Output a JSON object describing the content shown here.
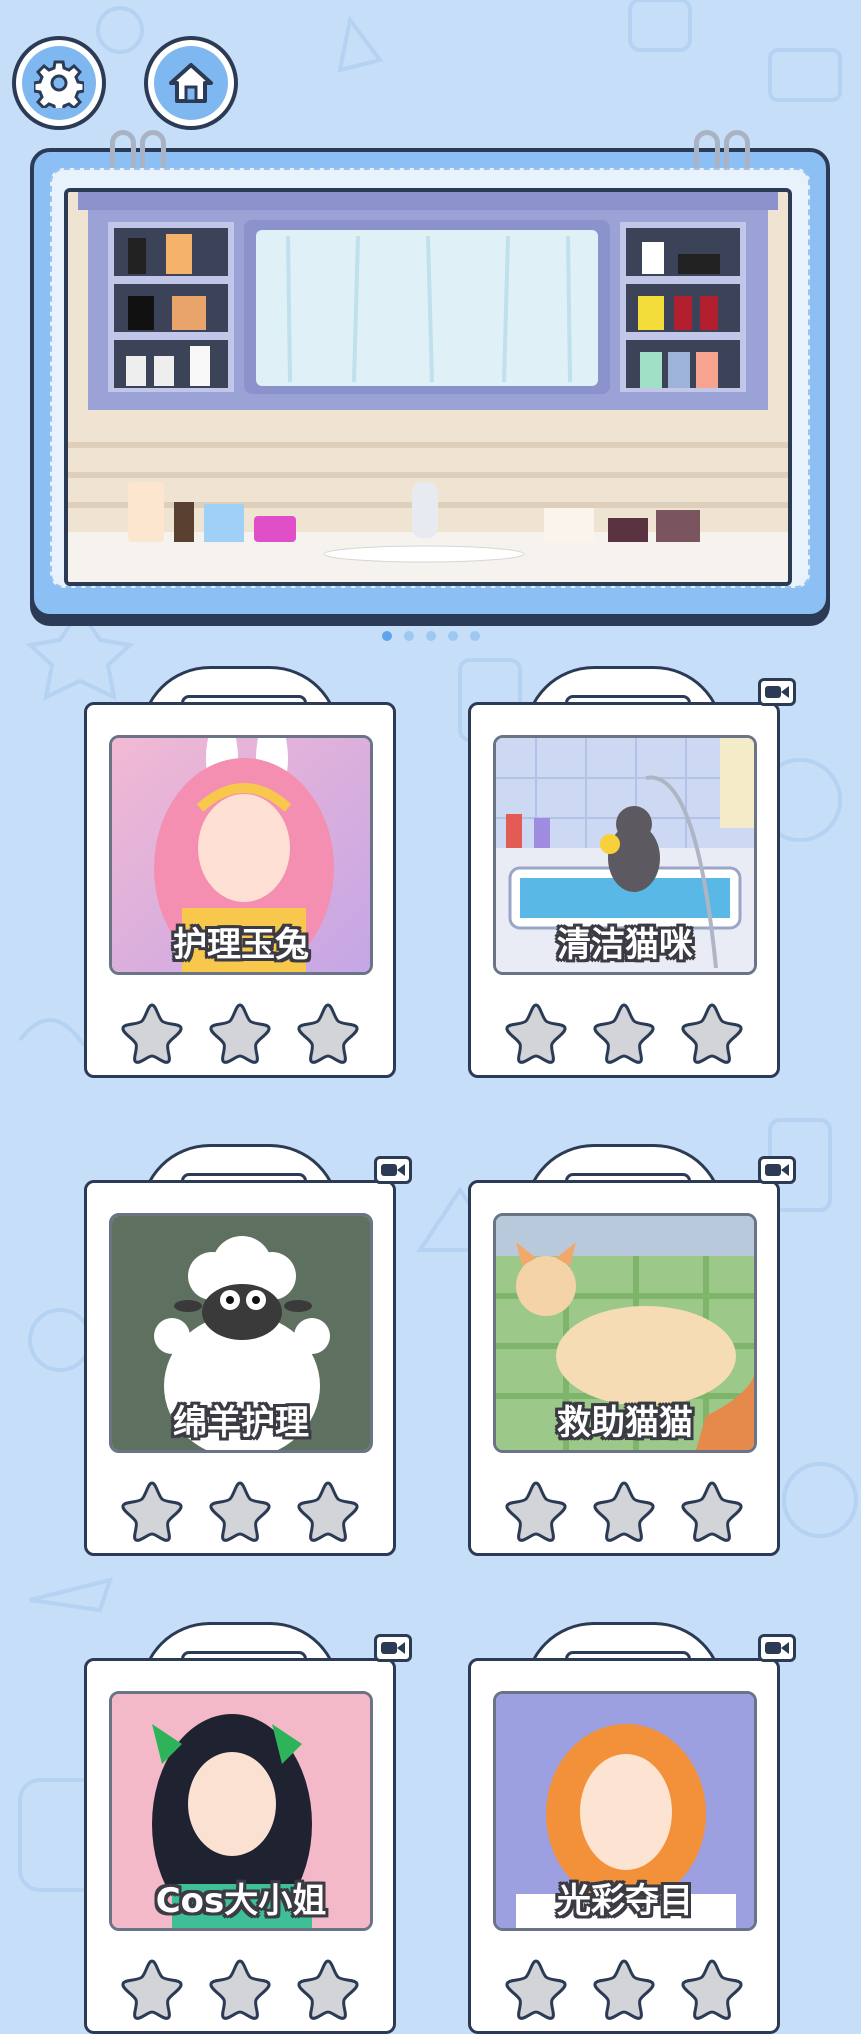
{
  "topbar": {
    "settings_icon": "gear-icon",
    "home_icon": "home-icon"
  },
  "banner": {
    "scene": "bathroom-vanity",
    "page_count": 5,
    "active_page": 1
  },
  "levels": [
    {
      "title": "护理玉兔",
      "video": false,
      "stars": 0,
      "image": "bunny-girl"
    },
    {
      "title": "清洁猫咪",
      "video": true,
      "stars": 0,
      "image": "cat-bath"
    },
    {
      "title": "绵羊护理",
      "video": true,
      "stars": 0,
      "image": "sheep"
    },
    {
      "title": "救助猫猫",
      "video": true,
      "stars": 0,
      "image": "cat-rescue"
    },
    {
      "title": "Cos大小姐",
      "video": true,
      "stars": 0,
      "image": "cosplay-girl"
    },
    {
      "title": "光彩夺目",
      "video": true,
      "stars": 0,
      "image": "glam-girl"
    }
  ],
  "colors": {
    "background": "#c6def8",
    "accent": "#7fb8f1",
    "outline": "#2b3a55",
    "star_empty": "#d3d4d8"
  }
}
